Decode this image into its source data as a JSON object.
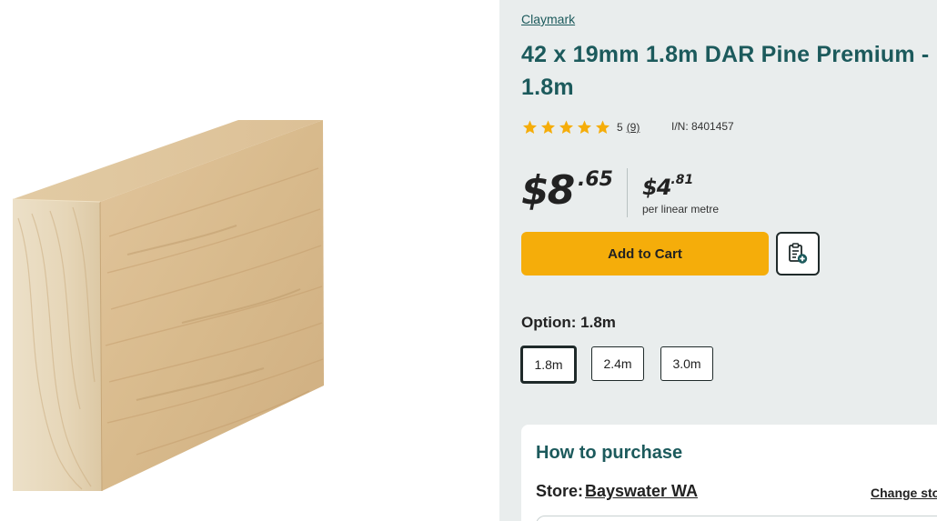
{
  "product": {
    "brand": "Claymark",
    "title": "42 x 19mm 1.8m DAR Pine Premium - 1.8m",
    "image_icon": "pine-timber-plank-image",
    "rating": {
      "score": "5",
      "count": "(9)",
      "stars_filled": 5,
      "stars_total": 5,
      "star_color": "#f5ad0a"
    },
    "item_number": "I/N: 8401457"
  },
  "price": {
    "dollars": "$8",
    "cents": ".65",
    "unit_dollars": "$4",
    "unit_cents": ".81",
    "unit_label": "per linear metre"
  },
  "actions": {
    "add_to_cart": "Add to Cart",
    "add_to_list_icon": "add-to-list-icon"
  },
  "options": {
    "heading": "Option: 1.8m",
    "items": [
      {
        "label": "1.8m",
        "selected": true
      },
      {
        "label": "2.4m",
        "selected": false
      },
      {
        "label": "3.0m",
        "selected": false
      }
    ]
  },
  "purchase": {
    "title": "How to purchase",
    "store_label": "Store:",
    "store_name": "Bayswater WA",
    "change_label": "Change sto"
  },
  "colors": {
    "brand_teal": "#1c5a5c",
    "accent_yellow": "#f5ad0a",
    "panel_bg": "#e9eded"
  }
}
